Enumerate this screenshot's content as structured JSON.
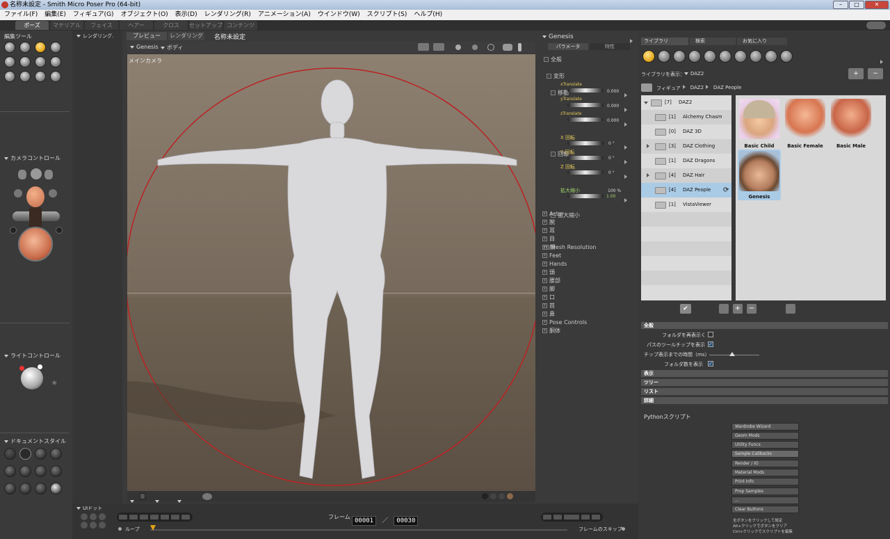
{
  "window": {
    "title": "名称未設定 - Smith Micro Poser Pro  (64-bit)"
  },
  "menu": [
    "ファイル(F)",
    "編集(E)",
    "フィギュア(G)",
    "オブジェクト(O)",
    "表示(D)",
    "レンダリング(R)",
    "アニメーション(A)",
    "ウインドウ(W)",
    "スクリプト(S)",
    "ヘルプ(H)"
  ],
  "rooms": [
    "ポーズ",
    "マテリアル",
    "フェイス",
    "ヘアー",
    "クロス",
    "セットアップ",
    "コンテンツ"
  ],
  "left": {
    "edit_tools_title": "編集ツール",
    "camera_title": "カメラコントロール",
    "light_title": "ライトコントロール",
    "docstyle_title": "ドキュメントスタイル",
    "udots_title": "UIドット",
    "render_label": "レンダリング."
  },
  "doc": {
    "tabs": [
      "プレビュー",
      "レンダリング"
    ],
    "doc_title": "名称未設定",
    "figure_menu": "Genesis",
    "actor_menu": "ボディ",
    "camera_label": "メインカメラ"
  },
  "params": {
    "figure": "Genesis",
    "tabs": [
      "パラメータ",
      "特性"
    ],
    "groups": [
      "全般",
      "変形",
      "移動"
    ],
    "translate": [
      {
        "label": "xTranslate",
        "value": "0.000"
      },
      {
        "label": "yTranslate",
        "value": "0.000"
      },
      {
        "label": "zTranslate",
        "value": "0.000"
      }
    ],
    "rotate_group": "回転",
    "rotate": [
      {
        "label": "X 回転",
        "value": "0 °"
      },
      {
        "label": "Y 回転",
        "value": "0 °"
      },
      {
        "label": "Z 回転",
        "value": "0 °"
      }
    ],
    "scale_group": "拡大縮小",
    "scale": {
      "label": "拡大縮小",
      "value": "100 %",
      "value2": "1.00"
    },
    "mesh": "Mesh Resolution",
    "items": [
      "Actor",
      "腕",
      "耳",
      "目",
      "顔",
      "Feet",
      "Hands",
      "頭",
      "腰部",
      "脚",
      "口",
      "首",
      "鼻",
      "Pose Controls",
      "胴体"
    ]
  },
  "library": {
    "tabs": [
      "ライブラリ",
      "検索",
      "お気に入り"
    ],
    "show_label": "ライブラリを表示：",
    "show_value": "DAZ2",
    "breadcrumb": [
      "フィギュア",
      "DAZ2",
      "DAZ People"
    ],
    "tree": [
      {
        "count": "[7]",
        "name": "DAZ2"
      },
      {
        "count": "[1]",
        "name": "Alchemy Chasm"
      },
      {
        "count": "[0]",
        "name": "DAZ 3D"
      },
      {
        "count": "[3]",
        "name": "DAZ Clothing"
      },
      {
        "count": "[1]",
        "name": "DAZ Dragons"
      },
      {
        "count": "[4]",
        "name": "DAZ Hair"
      },
      {
        "count": "[4]",
        "name": "DAZ People"
      },
      {
        "count": "[1]",
        "name": "VistaViewer"
      }
    ],
    "thumbs": [
      "Basic Child",
      "Basic Female",
      "Basic Male",
      "Genesis"
    ],
    "sections": {
      "general": "全般",
      "display": "表示",
      "tree": "ツリー",
      "list": "リスト",
      "detail": "詳細"
    },
    "options": [
      {
        "label": "フォルダを再表示く",
        "checked": false
      },
      {
        "label": "パスのツールチップを表示",
        "checked": true
      },
      {
        "label": "チップ表示までの時間（ms）",
        "checked": null
      },
      {
        "label": "フォルダ数を表示",
        "checked": true
      }
    ]
  },
  "python": {
    "title": "Pythonスクリプト",
    "buttons": [
      "Wardrobe Wizard",
      "Geom Mods",
      "Utility Funcs",
      "Sample Callbacks",
      "Render / IO",
      "Material Mods",
      "Print Info",
      "Prop Samples",
      "...",
      "Clear Buttons"
    ],
    "notes": [
      "全ボタンをクリックして設定",
      "Alt+クリックでボタンをクリア",
      "Ctrl+クリックでスクリプトを編集"
    ]
  },
  "anim": {
    "frame_label": "フレーム",
    "current": "00001",
    "separator": "／",
    "total": "00030",
    "loop_label": "ループ",
    "skip_label": "フレームのスキップ"
  },
  "colors": {
    "accent": "#e1a215",
    "bg": "#3a3a3a",
    "viewport": "#7f7264",
    "select": "#aacbe6"
  }
}
